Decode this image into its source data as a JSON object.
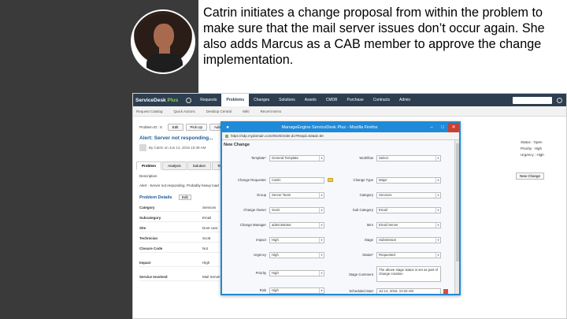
{
  "caption": "Catrin initiates a change proposal from within the problem to make sure that the mail server issues don’t occur again. She also adds Marcus as a CAB member to approve the change implementation.",
  "app": {
    "logo_a": "ServiceDesk",
    "logo_b": "Plus",
    "nav_tabs": [
      "Requests",
      "Problems",
      "Changes",
      "Solutions",
      "Assets",
      "CMDB",
      "Purchase",
      "Contracts",
      "Admin"
    ],
    "active_tab": "Problems",
    "search_placeholder": "Type here to search",
    "subnav": [
      "Request Catalog",
      "Quick Actions",
      "Desktop Central",
      "Wiki",
      "Recent Items"
    ],
    "problem_id_label": "Problem ID : 5",
    "toolbar_buttons": [
      "Edit",
      "Pick Up",
      "Add New"
    ],
    "alert_title": "Alert: Server not responding...",
    "alert_by": "By Catrin on Jun 13, 2016 10:39 AM",
    "detail_tabs": [
      "Problem",
      "Analysis",
      "Solution",
      "Tasks"
    ],
    "description_label": "Description",
    "description_text": "Alert - Server not responding. Probably heavy load",
    "problem_details_heading": "Problem Details",
    "problem_details_edit": "Edit",
    "details": [
      {
        "k": "Category",
        "v": "Services"
      },
      {
        "k": "Subcategory",
        "v": "Email"
      },
      {
        "k": "Site",
        "v": "Dont care"
      },
      {
        "k": "Technician",
        "v": "Scott"
      },
      {
        "k": "Closure Code",
        "v": "Not"
      },
      {
        "k": "Impact",
        "v": "High"
      },
      {
        "k": "Service Involved",
        "v": "Mail Server"
      }
    ],
    "right_info": [
      "Status : Open",
      "Priority : High",
      "Urgency : High"
    ],
    "new_change_button": "New Change"
  },
  "popup": {
    "title": "ManageEngine ServiceDesk Plus - Mozilla Firefox",
    "url": "https://sdp.mydomain.com/WorkOrder.do?Reqid=53&id=50",
    "heading": "New Change",
    "left_fields": [
      {
        "label": "Template*",
        "value": "General Template"
      },
      {
        "label": "Change Requester",
        "value": "Catrin"
      },
      {
        "label": "Group",
        "value": "Server Team"
      },
      {
        "label": "Change Owner",
        "value": "Scott"
      },
      {
        "label": "Change Manager",
        "value": "administrator"
      },
      {
        "label": "Impact",
        "value": "High"
      },
      {
        "label": "Urgency",
        "value": "High"
      },
      {
        "label": "Priority",
        "value": "High"
      },
      {
        "label": "Risk",
        "value": "High"
      }
    ],
    "right_fields": [
      {
        "label": "Workflow",
        "value": "Select"
      },
      {
        "label": "Change Type",
        "value": "Major"
      },
      {
        "label": "Category",
        "value": "Services"
      },
      {
        "label": "Sub Category",
        "value": "Email"
      },
      {
        "label": "Item",
        "value": "Email Server"
      },
      {
        "label": "Stage",
        "value": "Submission"
      },
      {
        "label": "Status*",
        "value": "Requested"
      }
    ],
    "comment_label": "Stage Comment",
    "comment_text": "The above stage status is set as part of change creation",
    "scheduled_label": "Scheduled Start",
    "scheduled_value": "Jul 14, 2016, 10:33 AM"
  }
}
